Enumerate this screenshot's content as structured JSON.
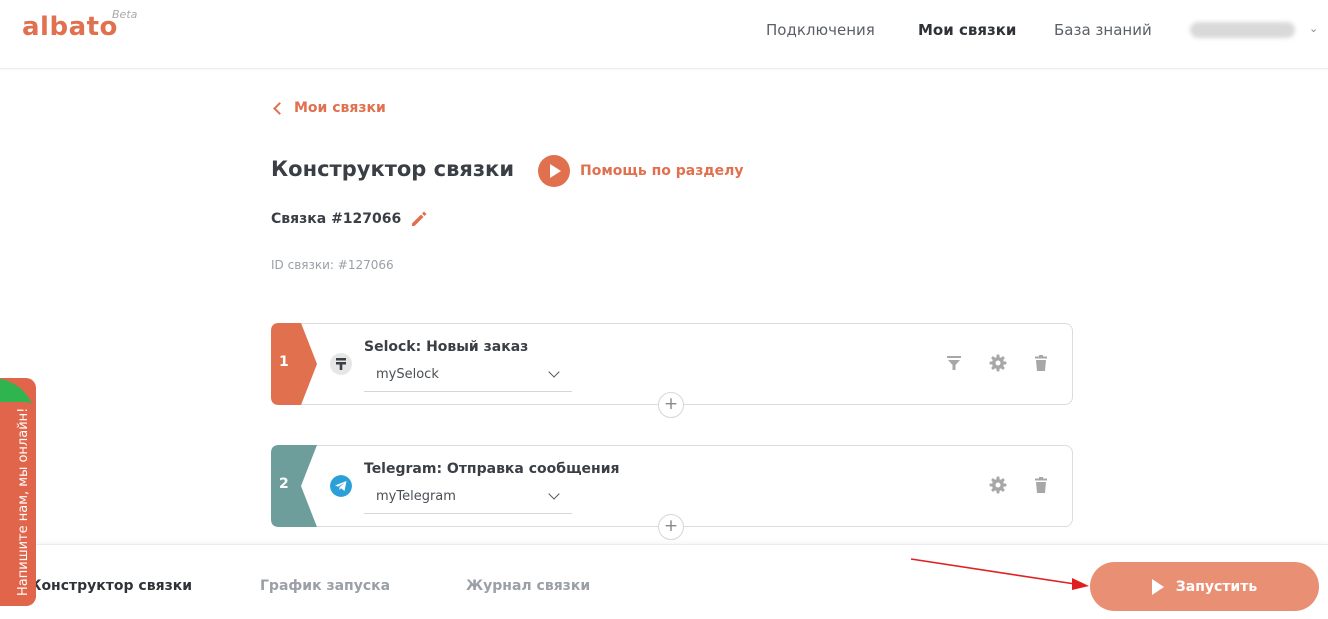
{
  "header": {
    "logo": "albato",
    "logo_badge": "Beta",
    "nav": [
      "Подключения",
      "Мои связки",
      "База знаний"
    ],
    "active_nav": "Мои связки"
  },
  "breadcrumb": {
    "back_label": "Мои связки"
  },
  "page": {
    "title": "Конструктор связки",
    "help_label": "Помощь по разделу",
    "link_name": "Связка #127066",
    "link_id": "ID связки: #127066"
  },
  "steps": [
    {
      "number": "1",
      "title": "Selock: Новый заказ",
      "account": "mySelock",
      "color": "#e0704e",
      "icon": "selock-icon",
      "has_filter": true
    },
    {
      "number": "2",
      "title": "Telegram: Отправка сообщения",
      "account": "myTelegram",
      "color": "#6e9e9b",
      "icon": "telegram-icon",
      "has_filter": false
    }
  ],
  "bottom_tabs": [
    "Конструктор связки",
    "График запуска",
    "Журнал связки"
  ],
  "active_tab": "Конструктор связки",
  "run_button": "Запустить",
  "chat_widget": "Напишите нам, мы онлайн!",
  "colors": {
    "accent": "#e0704e",
    "run_button": "#e88f74",
    "step2": "#6e9e9b",
    "arrow": "#e02020"
  }
}
